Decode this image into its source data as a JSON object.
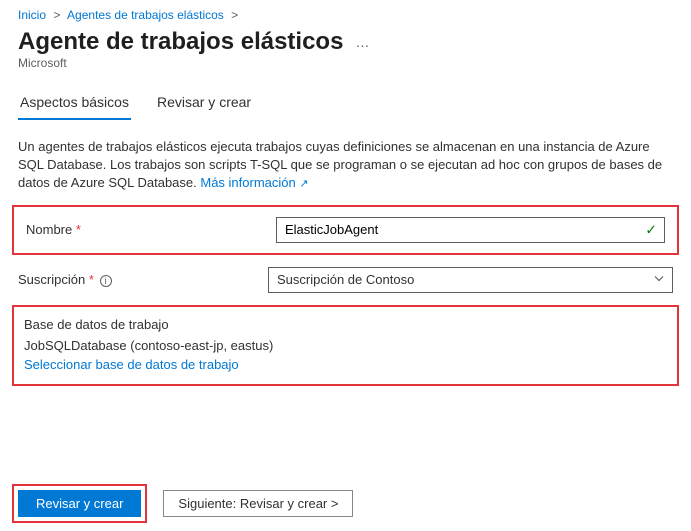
{
  "breadcrumb": {
    "home": "Inicio",
    "section": "Agentes de trabajos elásticos"
  },
  "page": {
    "title": "Agente de trabajos elásticos",
    "publisher": "Microsoft"
  },
  "tabs": {
    "basics": "Aspectos básicos",
    "review": "Revisar y crear"
  },
  "description": {
    "text": "Un agentes de trabajos elásticos ejecuta trabajos cuyas definiciones se almacenan en una instancia de Azure SQL Database. Los trabajos son scripts T-SQL que se programan o se ejecutan ad hoc con grupos de bases de datos de Azure SQL Database.",
    "more_link": "Más información"
  },
  "form": {
    "name_label": "Nombre",
    "name_value": "ElasticJobAgent",
    "subscription_label": "Suscripción",
    "subscription_value": "Suscripción de Contoso"
  },
  "job_db": {
    "heading": "Base de datos de trabajo",
    "value": "JobSQLDatabase (contoso-east-jp, eastus)",
    "select_link": "Seleccionar base de datos de trabajo"
  },
  "footer": {
    "review_create": "Revisar y crear",
    "next": "Siguiente: Revisar y crear  >"
  }
}
